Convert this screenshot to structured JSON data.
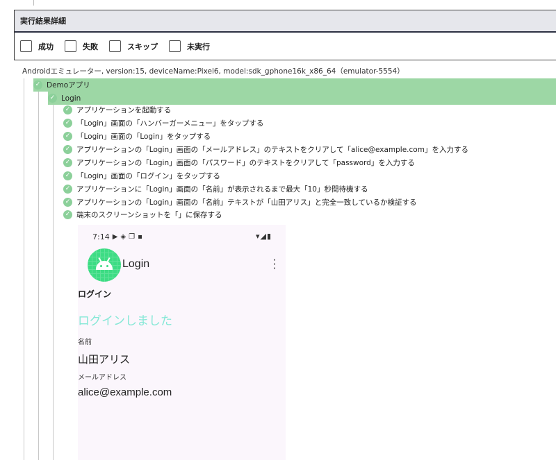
{
  "panel": {
    "title": "実行結果詳細",
    "filters": [
      {
        "label": "成功",
        "checked": false
      },
      {
        "label": "失敗",
        "checked": false
      },
      {
        "label": "スキップ",
        "checked": false
      },
      {
        "label": "未実行",
        "checked": false
      }
    ]
  },
  "device_line": "Androidエミュレーター, version:15, deviceName:Pixel6, model:sdk_gphone16k_x86_64（emulator-5554）",
  "tree": {
    "suite": "Demoアプリ",
    "scenario": "Login",
    "steps": [
      "アプリケーションを起動する",
      "「Login」画面の「ハンバーガーメニュー」をタップする",
      "「Login」画面の「Login」をタップする",
      "アプリケーションの「Login」画面の「メールアドレス」のテキストをクリアして「alice@example.com」を入力する",
      "アプリケーションの「Login」画面の「パスワード」のテキストをクリアして「password」を入力する",
      "「Login」画面の「ログイン」をタップする",
      "アプリケーションに「Login」画面の「名前」が表示されるまで最大「10」秒間待機する",
      "アプリケーションの「Login」画面の「名前」テキストが「山田アリス」と完全一致しているか検証する",
      "端末のスクリーンショットを「」に保存する"
    ],
    "status_color": "#8cd09a",
    "bar_color": "#9dd7a5"
  },
  "screenshot": {
    "time": "7:14",
    "app_title": "Login",
    "heading": "ログイン",
    "success_message": "ログインしました",
    "name_label": "名前",
    "name_value": "山田アリス",
    "email_label": "メールアドレス",
    "email_value": "alice@example.com",
    "accent_color": "#85e8d6"
  }
}
